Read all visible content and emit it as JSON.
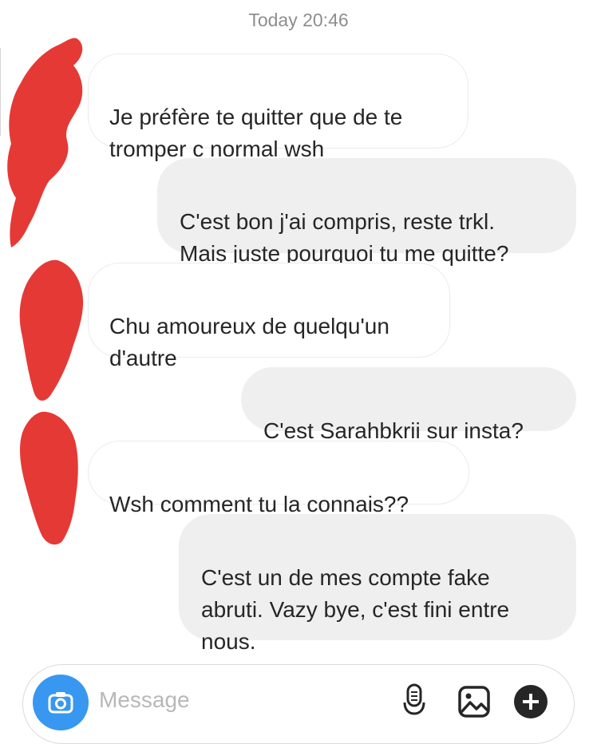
{
  "timestamp": "Today 20:46",
  "messages": [
    {
      "side": "in",
      "text": "Je préfère te quitter que de te\ntromper c normal wsh"
    },
    {
      "side": "out",
      "text": "C'est bon j'ai compris, reste trkl.\nMais juste pourquoi tu me quitte?"
    },
    {
      "side": "in",
      "text": "Chu amoureux de quelqu'un\nd'autre"
    },
    {
      "side": "out",
      "text": "C'est Sarahbkrii sur insta?"
    },
    {
      "side": "in",
      "text": "Wsh comment tu la connais??"
    },
    {
      "side": "out",
      "text": "C'est un de mes compte fake\nabruti. Vazy bye, c'est fini entre\nnous."
    }
  ],
  "composer": {
    "placeholder": "Message",
    "icons": [
      "camera-icon",
      "microphone-icon",
      "gallery-icon",
      "plus-icon"
    ]
  },
  "colors": {
    "timestamp": "#8e8e8e",
    "outgoing_bubble": "#efefef",
    "incoming_border": "#ebebeb",
    "camera_button": "#3897f0",
    "redaction": "#e53935"
  }
}
